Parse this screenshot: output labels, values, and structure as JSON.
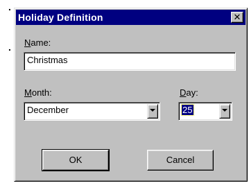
{
  "background": {
    "fragment_top": ".",
    "fragment_mid": "."
  },
  "dialog": {
    "title": "Holiday Definition",
    "close_glyph": "✕",
    "name": {
      "label_accel": "N",
      "label_rest": "ame:",
      "value": "Christmas"
    },
    "month": {
      "label_accel": "M",
      "label_rest": "onth:",
      "value": "December"
    },
    "day": {
      "label_accel": "D",
      "label_rest": "ay:",
      "value": "25"
    },
    "buttons": {
      "ok": "OK",
      "cancel": "Cancel"
    }
  },
  "colors": {
    "titlebar": "#000080",
    "face": "#c0c0c0",
    "selection": "#000080"
  },
  "icons": {
    "close": "close-icon",
    "dropdown": "chevron-down-icon"
  }
}
